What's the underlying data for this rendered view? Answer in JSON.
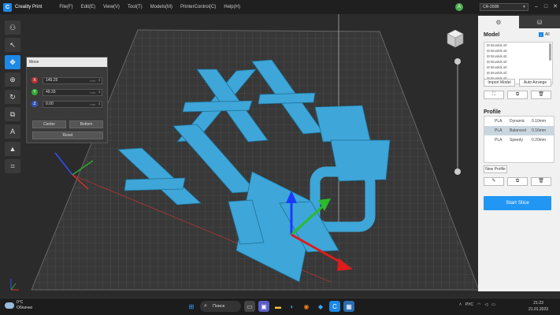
{
  "app": {
    "title": "Creality Print",
    "logo_letter": "C"
  },
  "menu": [
    "File(F)",
    "Edit(E)",
    "View(V)",
    "Tool(T)",
    "Models(M)",
    "PrinterControl(C)",
    "Help(H)"
  ],
  "account": {
    "initial": "A"
  },
  "printer": {
    "selected": "CR-200B"
  },
  "window_controls": [
    "–",
    "□",
    "✕"
  ],
  "move_panel": {
    "title": "Move",
    "x": "149.25",
    "y": "49.33",
    "z": "0.00",
    "unit": "mm",
    "center_label": "Center",
    "bottom_label": "Bottom",
    "reset_label": "Reset"
  },
  "right_panel": {
    "model_title": "Model",
    "all_label": "All",
    "models": [
      "Bruskik.stl",
      "Bruskik.stl",
      "Bruskik.stl",
      "Bruskik.stl",
      "Bruskik.stl",
      "Bruskik.stl",
      "Bruskik.stl"
    ],
    "import_label": "Import Model",
    "arrange_label": "Auto Arrange",
    "profile_title": "Profile",
    "profiles": [
      {
        "material": "PLA",
        "name": "Dynamic",
        "height": "0.10mm"
      },
      {
        "material": "PLA",
        "name": "Balanced",
        "height": "0.16mm"
      },
      {
        "material": "PLA",
        "name": "Speedy",
        "height": "0.20mm"
      }
    ],
    "new_profile_label": "New Profile",
    "start_slice_label": "Start Slice"
  },
  "taskbar": {
    "temp": "0°C",
    "weather": "Облачно",
    "search": "Поиск",
    "lang": "РУС",
    "time": "21:23",
    "date": "21.01.2023"
  },
  "colors": {
    "accent": "#1e88e5",
    "model": "#3ea6d8",
    "bed": "#3b3b3b"
  }
}
